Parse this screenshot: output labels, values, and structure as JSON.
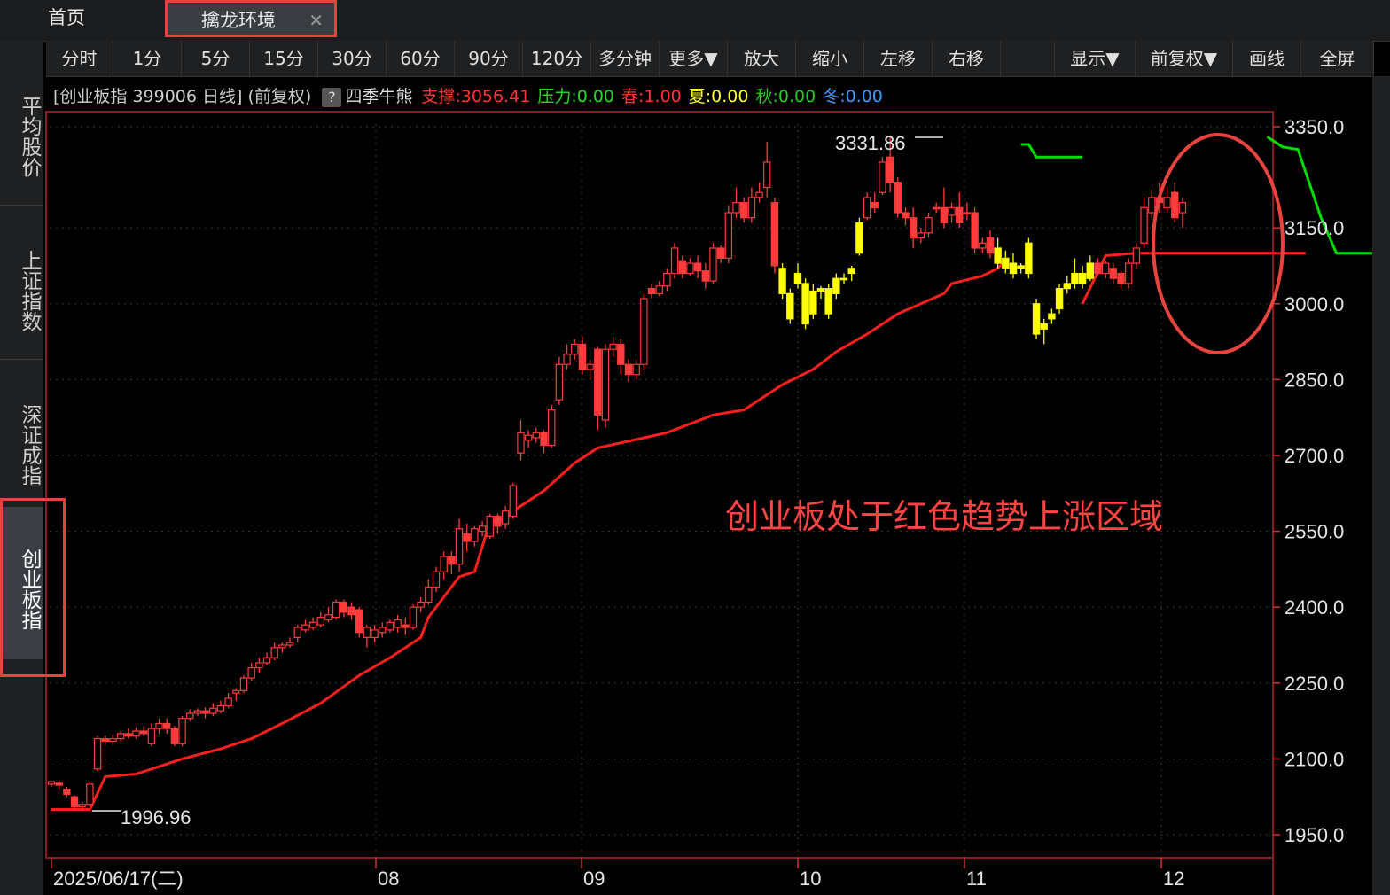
{
  "tabs": {
    "home": "首页",
    "active": "擒龙环境",
    "close": "✕"
  },
  "sidebar": [
    {
      "label": "平均股价"
    },
    {
      "label": "上证指数"
    },
    {
      "label": "深证成指"
    },
    {
      "label": "创业板指"
    }
  ],
  "toolbar": {
    "periods": [
      "分时",
      "1分",
      "5分",
      "15分",
      "30分",
      "60分",
      "90分",
      "120分",
      "多分钟",
      "更多▼"
    ],
    "actions": [
      "放大",
      "缩小",
      "左移",
      "右移"
    ],
    "right": [
      "显示▼",
      "前复权▼",
      "画线",
      "全屏"
    ]
  },
  "info": {
    "title": "[创业板指 399006 日线] (前复权)",
    "help": "?",
    "indicator": "四季牛熊",
    "support_label": "支撑:",
    "support_value": "3056.41",
    "pressure_label": "压力:",
    "pressure_value": "0.00",
    "spring_label": "春:",
    "spring_value": "1.00",
    "summer_label": "夏:",
    "summer_value": "0.00",
    "autumn_label": "秋:",
    "autumn_value": "0.00",
    "winter_label": "冬:",
    "winter_value": "0.00"
  },
  "colors": {
    "up": "#ff3b3b",
    "down": "#ff3b3b",
    "yellow": "#ffff00",
    "support": "#ff1f1f",
    "pressure": "#00dd00",
    "annotation": "#ff4444"
  },
  "chart_data": {
    "type": "candlestick",
    "title": "",
    "y_ticks": [
      "3350.0",
      "3150.0",
      "3000.0",
      "2850.0",
      "2700.0",
      "2550.0",
      "2400.0",
      "2250.0",
      "2100.0",
      "1950.0"
    ],
    "ylim": [
      1950,
      3350
    ],
    "x_ticks": [
      "2025/06/17(二)",
      "08",
      "09",
      "10",
      "11",
      "12"
    ],
    "annotations": {
      "high": "3331.86",
      "low": "1996.96",
      "note": "创业板处于红色趋势上涨区域"
    },
    "candles": [
      [
        2050,
        2055,
        2045,
        2050,
        "r"
      ],
      [
        2052,
        2048,
        2040,
        2058,
        "r"
      ],
      [
        2040,
        2030,
        2025,
        2045,
        "r"
      ],
      [
        2025,
        2005,
        2000,
        2028,
        "r"
      ],
      [
        2005,
        2010,
        1997,
        2015,
        "r"
      ],
      [
        2010,
        2050,
        2005,
        2055,
        "r"
      ],
      [
        2080,
        2140,
        2075,
        2145,
        "r"
      ],
      [
        2140,
        2135,
        2128,
        2145,
        "r"
      ],
      [
        2135,
        2140,
        2128,
        2148,
        "r"
      ],
      [
        2140,
        2150,
        2135,
        2155,
        "r"
      ],
      [
        2150,
        2145,
        2140,
        2160,
        "r"
      ],
      [
        2145,
        2155,
        2140,
        2162,
        "r"
      ],
      [
        2155,
        2150,
        2145,
        2165,
        "r"
      ],
      [
        2130,
        2160,
        2125,
        2170,
        "r"
      ],
      [
        2160,
        2170,
        2150,
        2180,
        "r"
      ],
      [
        2170,
        2160,
        2150,
        2180,
        "r"
      ],
      [
        2160,
        2130,
        2125,
        2165,
        "r"
      ],
      [
        2130,
        2180,
        2125,
        2185,
        "r"
      ],
      [
        2180,
        2190,
        2175,
        2198,
        "r"
      ],
      [
        2190,
        2195,
        2185,
        2200,
        "r"
      ],
      [
        2195,
        2190,
        2180,
        2202,
        "r"
      ],
      [
        2190,
        2200,
        2185,
        2210,
        "r"
      ],
      [
        2195,
        2205,
        2190,
        2215,
        "r"
      ],
      [
        2205,
        2220,
        2200,
        2230,
        "r"
      ],
      [
        2230,
        2235,
        2215,
        2240,
        "r"
      ],
      [
        2235,
        2260,
        2230,
        2265,
        "r"
      ],
      [
        2260,
        2280,
        2255,
        2290,
        "r"
      ],
      [
        2280,
        2290,
        2270,
        2300,
        "r"
      ],
      [
        2290,
        2300,
        2285,
        2310,
        "r"
      ],
      [
        2300,
        2320,
        2295,
        2330,
        "r"
      ],
      [
        2320,
        2325,
        2310,
        2330,
        "r"
      ],
      [
        2325,
        2330,
        2320,
        2340,
        "r"
      ],
      [
        2340,
        2360,
        2330,
        2365,
        "r"
      ],
      [
        2355,
        2365,
        2350,
        2375,
        "r"
      ],
      [
        2360,
        2370,
        2355,
        2380,
        "r"
      ],
      [
        2365,
        2380,
        2360,
        2390,
        "r"
      ],
      [
        2375,
        2385,
        2370,
        2400,
        "r"
      ],
      [
        2380,
        2410,
        2375,
        2415,
        "r"
      ],
      [
        2410,
        2390,
        2380,
        2415,
        "r"
      ],
      [
        2400,
        2385,
        2375,
        2410,
        "r"
      ],
      [
        2395,
        2350,
        2340,
        2400,
        "r"
      ],
      [
        2340,
        2360,
        2320,
        2365,
        "r"
      ],
      [
        2340,
        2355,
        2330,
        2365,
        "r"
      ],
      [
        2350,
        2360,
        2340,
        2370,
        "r"
      ],
      [
        2355,
        2370,
        2350,
        2375,
        "r"
      ],
      [
        2360,
        2375,
        2350,
        2385,
        "r"
      ],
      [
        2365,
        2360,
        2345,
        2380,
        "r"
      ],
      [
        2360,
        2400,
        2355,
        2405,
        "r"
      ],
      [
        2400,
        2410,
        2390,
        2420,
        "r"
      ],
      [
        2410,
        2440,
        2405,
        2455,
        "r"
      ],
      [
        2440,
        2470,
        2430,
        2480,
        "r"
      ],
      [
        2470,
        2500,
        2455,
        2510,
        "r"
      ],
      [
        2500,
        2485,
        2465,
        2510,
        "r"
      ],
      [
        2485,
        2555,
        2470,
        2575,
        "r"
      ],
      [
        2545,
        2530,
        2510,
        2565,
        "r"
      ],
      [
        2530,
        2555,
        2520,
        2560,
        "r"
      ],
      [
        2550,
        2560,
        2540,
        2570,
        "r"
      ],
      [
        2540,
        2580,
        2535,
        2585,
        "r"
      ],
      [
        2580,
        2560,
        2545,
        2585,
        "r"
      ],
      [
        2565,
        2590,
        2555,
        2600,
        "r"
      ],
      [
        2580,
        2640,
        2575,
        2645,
        "r"
      ],
      [
        2705,
        2745,
        2690,
        2770,
        "r"
      ],
      [
        2730,
        2740,
        2715,
        2750,
        "r"
      ],
      [
        2735,
        2745,
        2725,
        2755,
        "r"
      ],
      [
        2745,
        2720,
        2705,
        2750,
        "r"
      ],
      [
        2720,
        2790,
        2715,
        2800,
        "r"
      ],
      [
        2810,
        2880,
        2800,
        2895,
        "r"
      ],
      [
        2880,
        2900,
        2870,
        2920,
        "r"
      ],
      [
        2900,
        2920,
        2890,
        2930,
        "r"
      ],
      [
        2920,
        2870,
        2860,
        2935,
        "r"
      ],
      [
        2870,
        2880,
        2850,
        2890,
        "r"
      ],
      [
        2910,
        2780,
        2750,
        2915,
        "r"
      ],
      [
        2770,
        2910,
        2755,
        2920,
        "r"
      ],
      [
        2910,
        2920,
        2895,
        2935,
        "r"
      ],
      [
        2920,
        2880,
        2860,
        2930,
        "r"
      ],
      [
        2880,
        2860,
        2845,
        2890,
        "r"
      ],
      [
        2860,
        2880,
        2850,
        2890,
        "r"
      ],
      [
        2880,
        3010,
        2870,
        3020,
        "r"
      ],
      [
        3030,
        3020,
        3010,
        3040,
        "r"
      ],
      [
        3020,
        3035,
        3015,
        3045,
        "r"
      ],
      [
        3035,
        3060,
        3025,
        3070,
        "r"
      ],
      [
        3060,
        3110,
        3050,
        3120,
        "r"
      ],
      [
        3085,
        3060,
        3050,
        3095,
        "r"
      ],
      [
        3060,
        3080,
        3055,
        3090,
        "r"
      ],
      [
        3080,
        3065,
        3050,
        3095,
        "r"
      ],
      [
        3065,
        3045,
        3030,
        3080,
        "r"
      ],
      [
        3045,
        3110,
        3040,
        3120,
        "r"
      ],
      [
        3110,
        3090,
        3080,
        3115,
        "r"
      ],
      [
        3090,
        3180,
        3080,
        3195,
        "r"
      ],
      [
        3180,
        3200,
        3170,
        3230,
        "r"
      ],
      [
        3200,
        3170,
        3160,
        3210,
        "r"
      ],
      [
        3170,
        3210,
        3160,
        3230,
        "r"
      ],
      [
        3210,
        3220,
        3200,
        3240,
        "r"
      ],
      [
        3230,
        3280,
        3210,
        3320,
        "r"
      ],
      [
        3200,
        3075,
        3060,
        3210,
        "r"
      ],
      [
        3070,
        3020,
        3010,
        3080,
        "y"
      ],
      [
        3020,
        2970,
        2960,
        3030,
        "y"
      ],
      [
        3060,
        3040,
        3030,
        3080,
        "y"
      ],
      [
        3040,
        2960,
        2950,
        3050,
        "y"
      ],
      [
        2980,
        3025,
        2970,
        3040,
        "y"
      ],
      [
        3025,
        3030,
        3010,
        3035,
        "y"
      ],
      [
        3030,
        2980,
        2970,
        3040,
        "y"
      ],
      [
        3020,
        3050,
        3010,
        3060,
        "y"
      ],
      [
        3050,
        3050,
        3040,
        3060,
        "y"
      ],
      [
        3070,
        3060,
        3045,
        3075,
        "y"
      ],
      [
        3100,
        3160,
        3095,
        3170,
        "y"
      ],
      [
        3170,
        3210,
        3165,
        3220,
        "r"
      ],
      [
        3200,
        3190,
        3180,
        3220,
        "r"
      ],
      [
        3220,
        3280,
        3215,
        3290,
        "r"
      ],
      [
        3290,
        3240,
        3220,
        3330,
        "r"
      ],
      [
        3240,
        3180,
        3170,
        3250,
        "r"
      ],
      [
        3180,
        3170,
        3155,
        3190,
        "r"
      ],
      [
        3170,
        3130,
        3110,
        3190,
        "r"
      ],
      [
        3130,
        3140,
        3120,
        3150,
        "r"
      ],
      [
        3140,
        3170,
        3130,
        3180,
        "r"
      ],
      [
        3190,
        3190,
        3180,
        3200,
        "r"
      ],
      [
        3190,
        3160,
        3150,
        3230,
        "r"
      ],
      [
        3175,
        3190,
        3160,
        3200,
        "r"
      ],
      [
        3190,
        3160,
        3150,
        3220,
        "r"
      ],
      [
        3180,
        3180,
        3165,
        3200,
        "r"
      ],
      [
        3180,
        3110,
        3100,
        3190,
        "r"
      ],
      [
        3110,
        3120,
        3100,
        3130,
        "r"
      ],
      [
        3130,
        3100,
        3090,
        3145,
        "r"
      ],
      [
        3110,
        3080,
        3070,
        3130,
        "y"
      ],
      [
        3090,
        3070,
        3060,
        3105,
        "y"
      ],
      [
        3080,
        3060,
        3050,
        3100,
        "y"
      ],
      [
        3070,
        3075,
        3060,
        3080,
        "y"
      ],
      [
        3120,
        3060,
        3050,
        3130,
        "y"
      ],
      [
        3000,
        2940,
        2930,
        3010,
        "y"
      ],
      [
        2950,
        2960,
        2920,
        2970,
        "y"
      ],
      [
        2970,
        2980,
        2960,
        2990,
        "y"
      ],
      [
        2990,
        3030,
        2980,
        3040,
        "y"
      ],
      [
        3030,
        3040,
        3020,
        3055,
        "y"
      ],
      [
        3040,
        3060,
        3030,
        3090,
        "y"
      ],
      [
        3060,
        3040,
        3030,
        3075,
        "y"
      ],
      [
        3050,
        3080,
        3045,
        3095,
        "y"
      ],
      [
        3080,
        3060,
        3055,
        3090,
        "r"
      ],
      [
        3060,
        3080,
        3050,
        3085,
        "r"
      ],
      [
        3070,
        3050,
        3040,
        3080,
        "r"
      ],
      [
        3060,
        3040,
        3030,
        3065,
        "r"
      ],
      [
        3040,
        3080,
        3030,
        3090,
        "r"
      ],
      [
        3080,
        3110,
        3070,
        3120,
        "r"
      ],
      [
        3120,
        3190,
        3110,
        3210,
        "r"
      ],
      [
        3180,
        3210,
        3170,
        3225,
        "r"
      ],
      [
        3210,
        3200,
        3180,
        3240,
        "r"
      ],
      [
        3190,
        3210,
        3180,
        3230,
        "r"
      ],
      [
        3220,
        3170,
        3160,
        3240,
        "r"
      ],
      [
        3180,
        3200,
        3150,
        3210,
        "r"
      ]
    ],
    "support_segments": [
      [
        [
          0,
          2000
        ],
        [
          5,
          2000
        ],
        [
          7,
          2065
        ],
        [
          11,
          2070
        ],
        [
          17,
          2100
        ],
        [
          22,
          2120
        ],
        [
          26,
          2140
        ],
        [
          30,
          2170
        ],
        [
          35,
          2210
        ],
        [
          40,
          2265
        ],
        [
          44,
          2300
        ],
        [
          48,
          2340
        ],
        [
          49,
          2380
        ],
        [
          50,
          2400
        ],
        [
          53,
          2460
        ],
        [
          55,
          2470
        ],
        [
          57,
          2570
        ],
        [
          59,
          2575
        ],
        [
          60,
          2590
        ],
        [
          64,
          2630
        ],
        [
          68,
          2685
        ],
        [
          71,
          2715
        ],
        [
          80,
          2745
        ],
        [
          86,
          2780
        ],
        [
          90,
          2790
        ],
        [
          95,
          2840
        ],
        [
          99,
          2870
        ],
        [
          102,
          2905
        ],
        [
          106,
          2940
        ],
        [
          108,
          2960
        ],
        [
          110,
          2980
        ],
        [
          116,
          3020
        ],
        [
          117,
          3040
        ],
        [
          121,
          3055
        ],
        [
          123,
          3070
        ],
        [
          124,
          3085
        ]
      ],
      [
        [
          134,
          3000
        ],
        [
          137,
          3095
        ],
        [
          141,
          3100
        ],
        [
          163,
          3100
        ]
      ],
      [
        [
          172,
          2865
        ],
        [
          176,
          2870
        ],
        [
          180,
          2880
        ],
        [
          184,
          3050
        ],
        [
          188,
          3055
        ]
      ]
    ],
    "pressure_segments": [
      [
        [
          126,
          3315
        ],
        [
          127,
          3315
        ],
        [
          128,
          3290
        ],
        [
          134,
          3290
        ]
      ],
      [
        [
          158,
          3330
        ],
        [
          160,
          3310
        ],
        [
          162,
          3305
        ],
        [
          165,
          3170
        ],
        [
          167,
          3100
        ],
        [
          175,
          3100
        ]
      ]
    ]
  }
}
